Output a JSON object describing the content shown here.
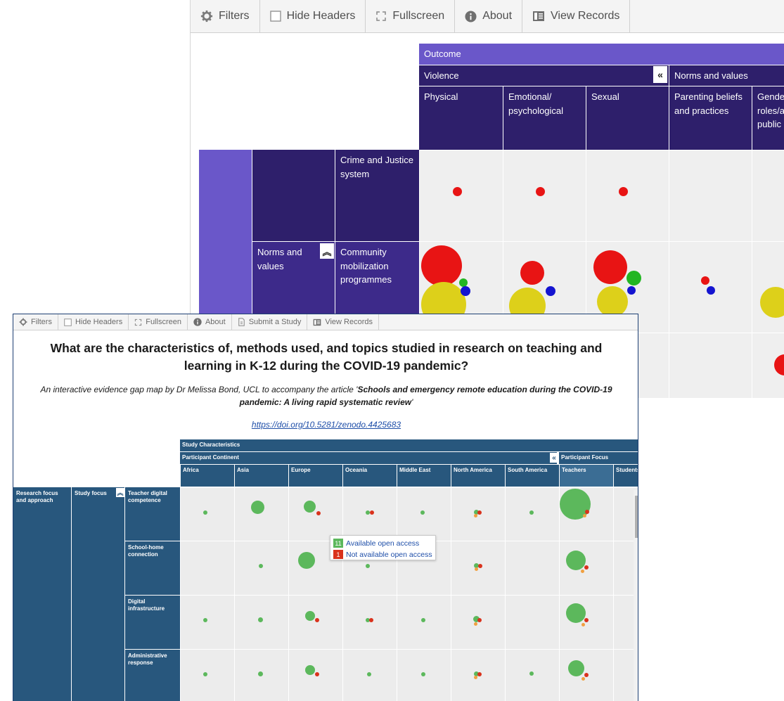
{
  "colors": {
    "purple_top": "#6a57c9",
    "purple_dark": "#2e1f6b",
    "purple_mid": "#3d2a8a",
    "cell_bg": "#efefef",
    "red": "#e81414",
    "green": "#22b622",
    "blue": "#1414d0",
    "yellow": "#ddd01a",
    "blue_header": "#28577d",
    "front_green": "#5cb85c",
    "front_red": "#d9321c",
    "front_orange": "#f0a040",
    "link": "#1e4ea8"
  },
  "back_window": {
    "toolbar": [
      {
        "label": "Filters",
        "icon": "gear-icon"
      },
      {
        "label": "Hide Headers",
        "icon": "checkbox-icon"
      },
      {
        "label": "Fullscreen",
        "icon": "fullscreen-icon"
      },
      {
        "label": "About",
        "icon": "info-icon"
      },
      {
        "label": "View Records",
        "icon": "records-icon"
      }
    ],
    "outcome_label": "Outcome",
    "groups": [
      "Violence",
      "Norms and values"
    ],
    "columns": [
      "Physical",
      "Emotional/ psychological",
      "Sexual",
      "Parenting beliefs and practices",
      "Gender roles/and public"
    ],
    "row_group": "Norms and values",
    "rows": [
      "Crime and Justice system",
      "Community mobilization programmes"
    ]
  },
  "front_window": {
    "toolbar": [
      {
        "label": "Filters",
        "icon": "gear-icon"
      },
      {
        "label": "Hide Headers",
        "icon": "checkbox-icon"
      },
      {
        "label": "Fullscreen",
        "icon": "fullscreen-icon"
      },
      {
        "label": "About",
        "icon": "info-icon"
      },
      {
        "label": "Submit a Study",
        "icon": "document-icon"
      },
      {
        "label": "View Records",
        "icon": "records-icon"
      }
    ],
    "title": "What are the characteristics of, methods used, and topics studied in research on teaching and learning in K-12 during the COVID-19 pandemic?",
    "subtitle_prefix": "An interactive evidence gap map by Dr Melissa Bond, UCL to accompany the article '",
    "subtitle_article": "Schools and emergency remote education during the COVID-19 pandemic: A living rapid systematic review",
    "subtitle_suffix": "'",
    "link": "https://doi.org/10.5281/zenodo.4425683",
    "header_top": "Study Characteristics",
    "header_group1": "Participant Continent",
    "header_group2": "Participant Focus",
    "columns": [
      "Africa",
      "Asia",
      "Europe",
      "Oceania",
      "Middle East",
      "North America",
      "South America",
      "Teachers",
      "Students"
    ],
    "row_header1": "Research focus and approach",
    "row_header2": "Study focus",
    "rows": [
      "Teacher digital competence",
      "School-home connection",
      "Digital infrastructure",
      "Administrative response"
    ],
    "tooltip": [
      {
        "count": "11",
        "label": "Available open access",
        "color": "#5cb85c"
      },
      {
        "count": "1",
        "label": "Not available open access",
        "color": "#d9321c"
      }
    ]
  }
}
